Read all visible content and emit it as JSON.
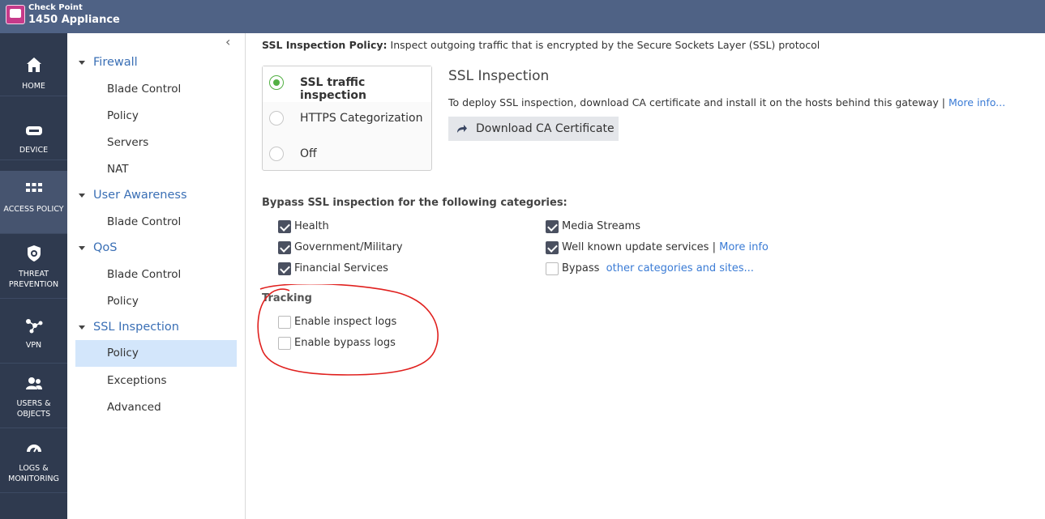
{
  "header": {
    "vendor": "Check Point",
    "product": "1450 Appliance"
  },
  "nav": [
    {
      "label": "HOME",
      "icon": "home-icon"
    },
    {
      "label": "DEVICE",
      "icon": "device-icon"
    },
    {
      "label": "ACCESS POLICY",
      "icon": "grid-icon",
      "active": true
    },
    {
      "label": "THREAT PREVENTION",
      "icon": "shield-icon"
    },
    {
      "label": "VPN",
      "icon": "vpn-icon"
    },
    {
      "label": "USERS & OBJECTS",
      "icon": "users-icon"
    },
    {
      "label": "LOGS & MONITORING",
      "icon": "gauge-icon"
    }
  ],
  "tree": {
    "collapse_icon": "‹",
    "groups": [
      {
        "label": "Firewall",
        "items": [
          "Blade Control",
          "Policy",
          "Servers",
          "NAT"
        ]
      },
      {
        "label": "User Awareness",
        "items": [
          "Blade Control"
        ]
      },
      {
        "label": "QoS",
        "items": [
          "Blade Control",
          "Policy"
        ]
      },
      {
        "label": "SSL Inspection",
        "items": [
          "Policy",
          "Exceptions",
          "Advanced"
        ],
        "selected": "Policy"
      }
    ]
  },
  "main": {
    "policy_label": "SSL Inspection Policy:",
    "policy_desc": "Inspect outgoing traffic that is encrypted by the Secure Sockets Layer (SSL) protocol",
    "modes": [
      {
        "label": "SSL traffic inspection",
        "selected": true
      },
      {
        "label": "HTTPS Categorization",
        "selected": false
      },
      {
        "label": "Off",
        "selected": false
      }
    ],
    "ssl_title": "SSL Inspection",
    "ssl_desc": "To deploy SSL inspection, download CA certificate and install it on the hosts behind this gateway |",
    "more_info": "More info...",
    "download_button": "Download CA Certificate",
    "bypass_heading": "Bypass SSL inspection for the following categories:",
    "bypass_left": [
      {
        "label": "Health",
        "checked": true
      },
      {
        "label": "Government/Military",
        "checked": true
      },
      {
        "label": "Financial Services",
        "checked": true
      }
    ],
    "bypass_right": [
      {
        "label": "Media Streams",
        "checked": true
      },
      {
        "label": "Well known update services |",
        "link": "More info",
        "checked": true
      },
      {
        "label": "Bypass",
        "link": "other categories and sites...",
        "checked": false
      }
    ],
    "tracking_heading": "Tracking",
    "tracking": [
      {
        "label": "Enable inspect logs",
        "checked": false
      },
      {
        "label": "Enable bypass logs",
        "checked": false
      }
    ]
  },
  "colors": {
    "topbar": "#4f6285",
    "sidebar": "#2f3a4f",
    "link": "#3a7bd5",
    "annotation": "#e0201e"
  }
}
